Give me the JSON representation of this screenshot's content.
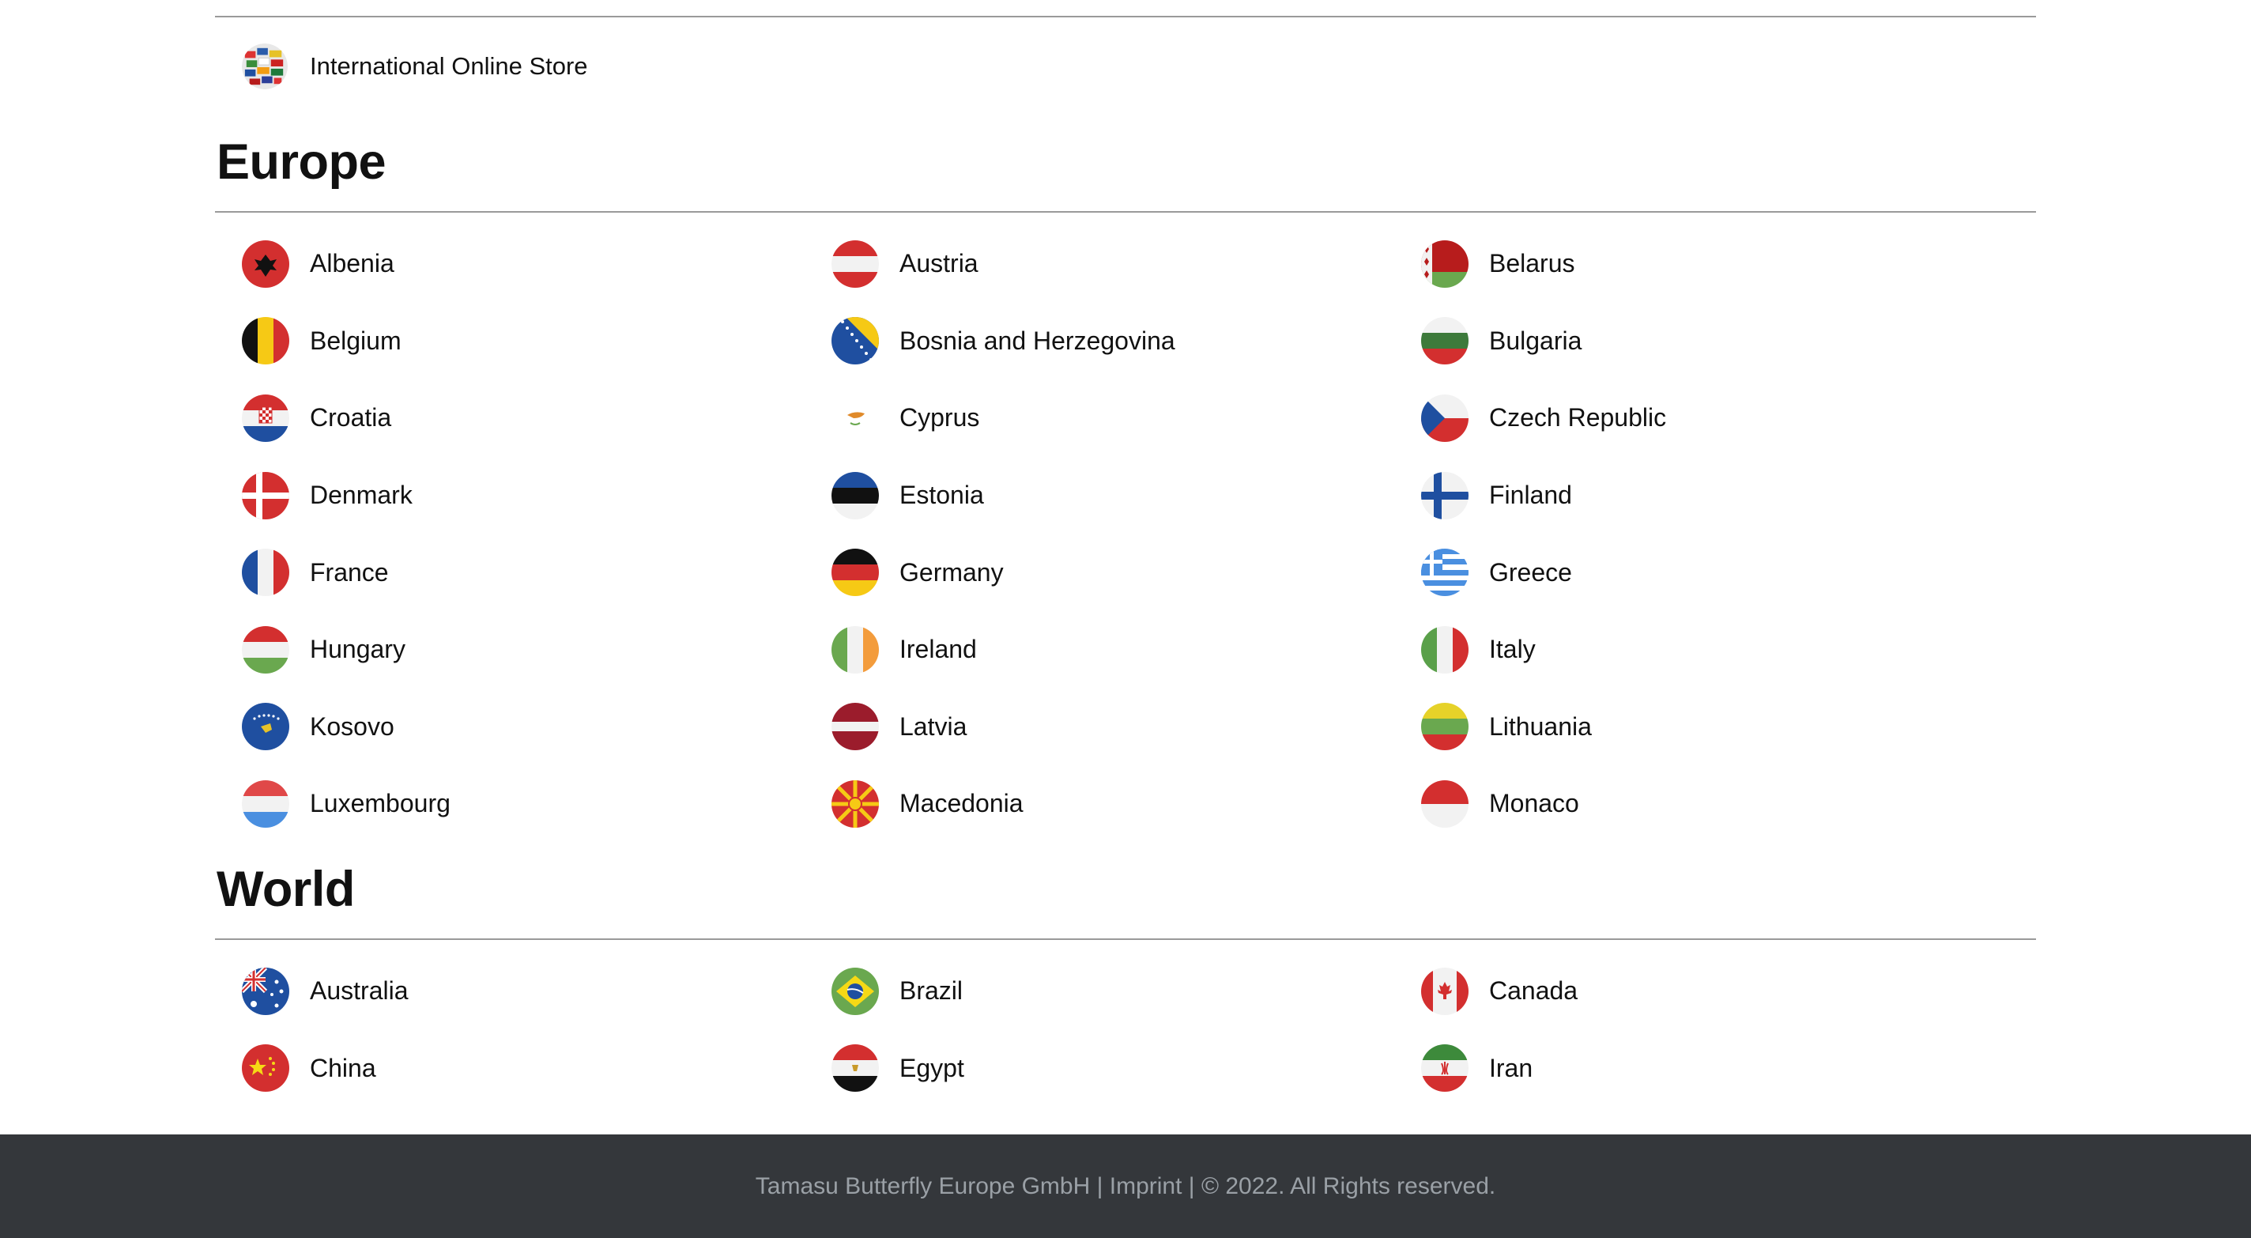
{
  "store": {
    "label": "International Online Store",
    "icon": "globe-flags-icon"
  },
  "europe": {
    "heading": "Europe",
    "countries": [
      {
        "name": "Albenia",
        "icon": "albania-flag-icon"
      },
      {
        "name": "Austria",
        "icon": "austria-flag-icon"
      },
      {
        "name": "Belarus",
        "icon": "belarus-flag-icon"
      },
      {
        "name": "Belgium",
        "icon": "belgium-flag-icon"
      },
      {
        "name": "Bosnia and Herzegovina",
        "icon": "bosnia-flag-icon"
      },
      {
        "name": "Bulgaria",
        "icon": "bulgaria-flag-icon"
      },
      {
        "name": "Croatia",
        "icon": "croatia-flag-icon"
      },
      {
        "name": "Cyprus",
        "icon": "cyprus-flag-icon"
      },
      {
        "name": "Czech Republic",
        "icon": "czech-flag-icon"
      },
      {
        "name": "Denmark",
        "icon": "denmark-flag-icon"
      },
      {
        "name": "Estonia",
        "icon": "estonia-flag-icon"
      },
      {
        "name": "Finland",
        "icon": "finland-flag-icon"
      },
      {
        "name": "France",
        "icon": "france-flag-icon"
      },
      {
        "name": "Germany",
        "icon": "germany-flag-icon"
      },
      {
        "name": "Greece",
        "icon": "greece-flag-icon"
      },
      {
        "name": "Hungary",
        "icon": "hungary-flag-icon"
      },
      {
        "name": "Ireland",
        "icon": "ireland-flag-icon"
      },
      {
        "name": "Italy",
        "icon": "italy-flag-icon"
      },
      {
        "name": "Kosovo",
        "icon": "kosovo-flag-icon"
      },
      {
        "name": "Latvia",
        "icon": "latvia-flag-icon"
      },
      {
        "name": "Lithuania",
        "icon": "lithuania-flag-icon"
      },
      {
        "name": "Luxembourg",
        "icon": "luxembourg-flag-icon"
      },
      {
        "name": "Macedonia",
        "icon": "macedonia-flag-icon"
      },
      {
        "name": "Monaco",
        "icon": "monaco-flag-icon"
      }
    ]
  },
  "world": {
    "heading": "World",
    "countries": [
      {
        "name": "Australia",
        "icon": "australia-flag-icon"
      },
      {
        "name": "Brazil",
        "icon": "brazil-flag-icon"
      },
      {
        "name": "Canada",
        "icon": "canada-flag-icon"
      },
      {
        "name": "China",
        "icon": "china-flag-icon"
      },
      {
        "name": "Egypt",
        "icon": "egypt-flag-icon"
      },
      {
        "name": "Iran",
        "icon": "iran-flag-icon"
      }
    ]
  },
  "footer": {
    "company": "Tamasu Butterfly Europe GmbH",
    "separator": "|",
    "imprint": "Imprint",
    "copyright": "© 2022. All Rights reserved."
  },
  "colors": {
    "footer_bg": "#34373b",
    "footer_text": "#9aa0a6",
    "rule": "#9a9a9a"
  }
}
